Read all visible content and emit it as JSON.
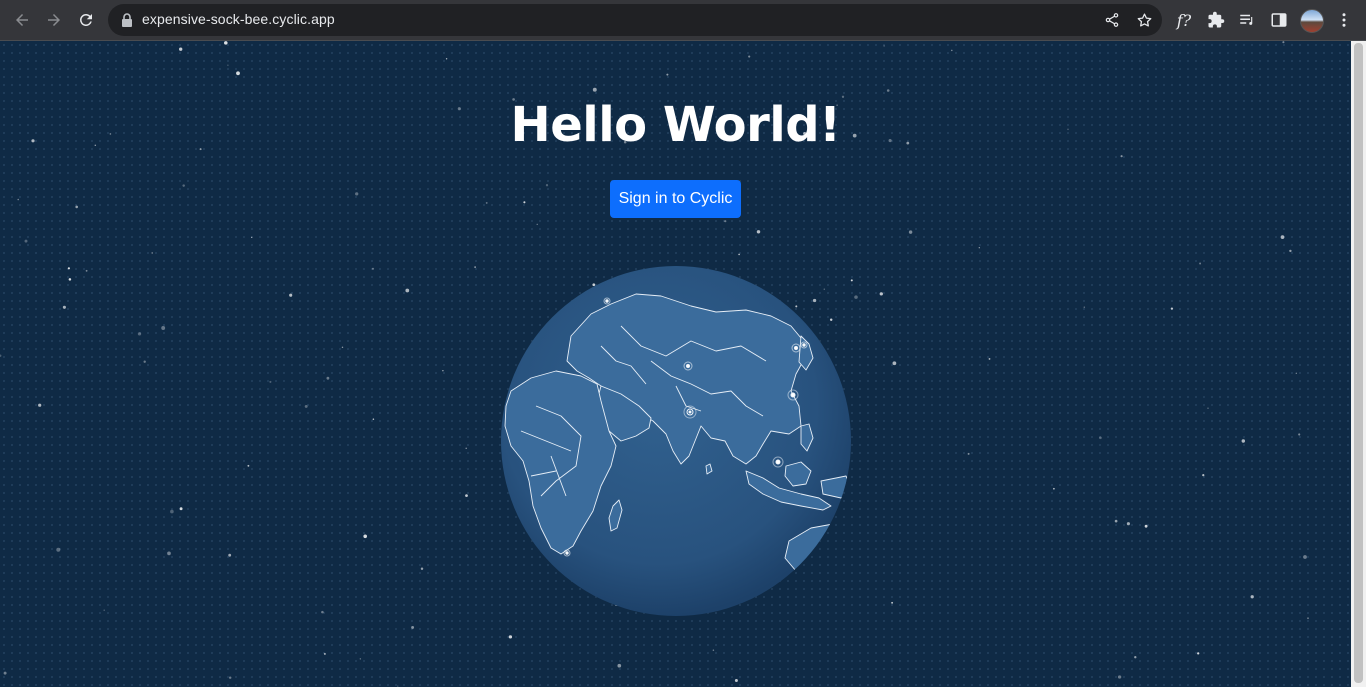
{
  "browser": {
    "url": "expensive-sock-bee.cyclic.app",
    "icons": [
      "back-arrow-icon",
      "forward-arrow-icon",
      "reload-icon",
      "lock-icon",
      "share-icon",
      "bookmark-star-icon",
      "formula-extension-icon",
      "puzzle-icon",
      "reading-list-icon",
      "side-panel-icon",
      "avatar",
      "kebab-menu-icon"
    ],
    "extension_label": "f?"
  },
  "page": {
    "title": "Hello World!",
    "signin_label": "Sign in to Cyclic"
  },
  "colors": {
    "background": "#0f2a45",
    "button": "#0d6efd",
    "globe": "#2c5a8a",
    "landmass_border": "#e6eef7"
  }
}
